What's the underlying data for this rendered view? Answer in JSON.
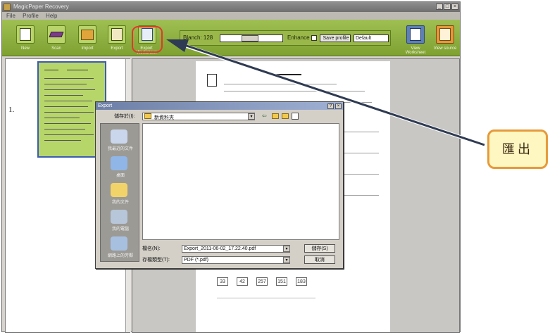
{
  "window": {
    "title": "MagicPaper Recovery",
    "controls": [
      "_",
      "□",
      "×"
    ]
  },
  "menu": [
    "File",
    "Profile",
    "Help"
  ],
  "toolbar": {
    "buttons": [
      {
        "label": "New",
        "icon": "new-document-icon"
      },
      {
        "label": "Scan",
        "icon": "scanner-icon"
      },
      {
        "label": "Import",
        "icon": "import-icon"
      },
      {
        "label": "Export",
        "icon": "export-icon"
      },
      {
        "label": "Export Worksheet",
        "icon": "export-worksheet-icon"
      }
    ],
    "right_buttons": [
      {
        "label": "View Worksheet",
        "icon": "view-worksheet-icon"
      },
      {
        "label": "View source",
        "icon": "view-source-icon"
      }
    ],
    "blanch_label": "Blanch: 128",
    "enhance_label": "Enhance",
    "save_profile_label": "Save profile",
    "profile_value": "Default"
  },
  "thumbnails": {
    "item_number": "1."
  },
  "document": {
    "answer_boxes": [
      "33",
      "42",
      "257",
      "151",
      "183"
    ]
  },
  "dialog": {
    "title": "Export",
    "save_in_label": "儲存於(I):",
    "save_in_value": "新資料夾",
    "places": [
      "我最近的文件",
      "桌面",
      "我的文件",
      "我的電腦",
      "網路上的芳鄰"
    ],
    "filename_label": "檔名(N):",
    "filename_value": "Export_2011-06-02_17.22.40.pdf",
    "filetype_label": "存檔類型(T):",
    "filetype_value": "PDF (*.pdf)",
    "save_button": "儲存(S)",
    "cancel_button": "取消",
    "help_glyph": "?",
    "close_glyph": "×"
  },
  "callout": {
    "text": "匯出"
  },
  "colors": {
    "toolbar_green": "#8fb040",
    "highlight_red": "#e0392b",
    "callout_border": "#e69a3a",
    "callout_fill": "#fff7c2",
    "arrow": "#2f3b52"
  }
}
